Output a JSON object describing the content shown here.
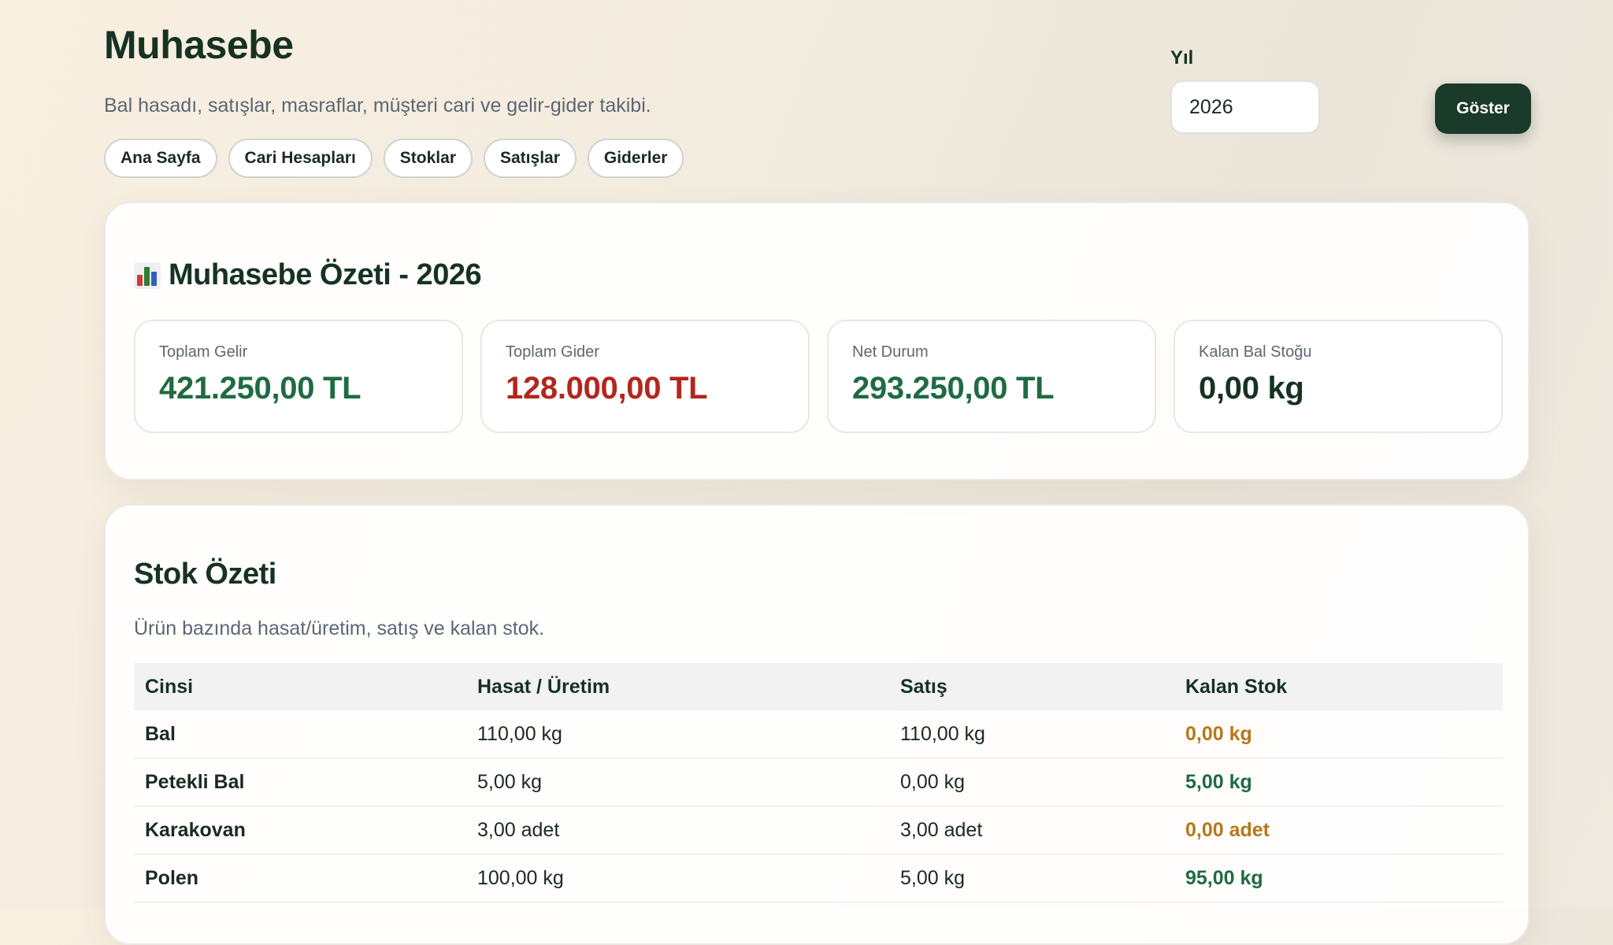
{
  "header": {
    "title": "Muhasebe",
    "subtitle": "Bal hasadı, satışlar, masraflar, müşteri cari ve gelir-gider takibi.",
    "nav": [
      {
        "label": "Ana Sayfa"
      },
      {
        "label": "Cari Hesapları"
      },
      {
        "label": "Stoklar"
      },
      {
        "label": "Satışlar"
      },
      {
        "label": "Giderler"
      }
    ],
    "year_label": "Yıl",
    "year_value": "2026",
    "show_button": "Göster"
  },
  "summary": {
    "title": "Muhasebe Özeti - 2026",
    "icon": "bar-chart-icon",
    "stats": [
      {
        "label": "Toplam Gelir",
        "value": "421.250,00 TL",
        "color": "#1f6b43"
      },
      {
        "label": "Toplam Gider",
        "value": "128.000,00 TL",
        "color": "#b3261e"
      },
      {
        "label": "Net Durum",
        "value": "293.250,00 TL",
        "color": "#1f6b43"
      },
      {
        "label": "Kalan Bal Stoğu",
        "value": "0,00 kg",
        "color": "#163223"
      }
    ]
  },
  "stock": {
    "title": "Stok Özeti",
    "description": "Ürün bazında hasat/üretim, satış ve kalan stok.",
    "columns": [
      "Cinsi",
      "Hasat / Üretim",
      "Satış",
      "Kalan Stok"
    ],
    "rows": [
      {
        "name": "Bal",
        "production": "110,00 kg",
        "sales": "110,00 kg",
        "remaining": "0,00 kg",
        "status_color": "#b7771a"
      },
      {
        "name": "Petekli Bal",
        "production": "5,00 kg",
        "sales": "0,00 kg",
        "remaining": "5,00 kg",
        "status_color": "#1f6b43"
      },
      {
        "name": "Karakovan",
        "production": "3,00 adet",
        "sales": "3,00 adet",
        "remaining": "0,00 adet",
        "status_color": "#b7771a"
      },
      {
        "name": "Polen",
        "production": "100,00 kg",
        "sales": "5,00 kg",
        "remaining": "95,00 kg",
        "status_color": "#1f6b43"
      }
    ]
  }
}
